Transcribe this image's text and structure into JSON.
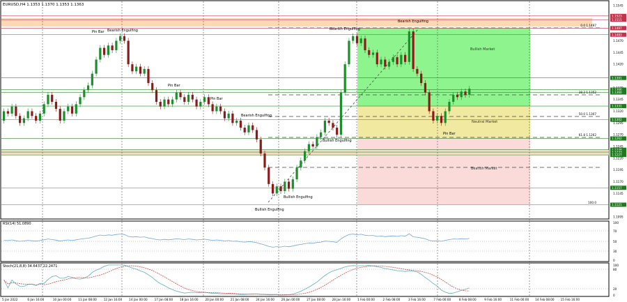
{
  "header": {
    "symbol_line": "EURUSD,H4  1.1353 1.1370 1.1353 1.1363"
  },
  "rsi_header": "RSI(14) 51.0890",
  "stoch_header": "Stoch(21,8,8) 34.6437 22.2471",
  "price_axis_ticks": [
    "1.1545",
    "1.1495",
    "1.1470",
    "1.1445",
    "1.1420",
    "1.1370",
    "1.1345",
    "1.1320",
    "1.1295",
    "1.1270",
    "1.1245",
    "1.1220",
    "1.1195",
    "1.1170",
    "1.1145",
    "1.1120",
    "1.1095"
  ],
  "price_tags": [
    {
      "value": "1.1523",
      "kind": "red"
    },
    {
      "value": "1.1515",
      "kind": "red"
    },
    {
      "value": "1.1497",
      "kind": "red"
    },
    {
      "value": "1.1483",
      "kind": "red"
    },
    {
      "value": "1.1391",
      "kind": "green"
    },
    {
      "value": "1.1366",
      "kind": "green"
    },
    {
      "value": "1.1360",
      "kind": "green"
    },
    {
      "value": "1.1331",
      "kind": "green"
    },
    {
      "value": "1.1302",
      "kind": "green"
    },
    {
      "value": "1.1262",
      "kind": "green"
    },
    {
      "value": "1.1238",
      "kind": "green"
    },
    {
      "value": "1.1233",
      "kind": "green"
    },
    {
      "value": "1.1227",
      "kind": "green"
    },
    {
      "value": "1.1157",
      "kind": "green"
    },
    {
      "value": "1.1121",
      "kind": "green"
    }
  ],
  "fib_labels": [
    {
      "text": "0.0",
      "value": "1.1497"
    },
    {
      "text": "38.2",
      "value": "1.1352"
    },
    {
      "text": "50.0",
      "value": "1.1307"
    },
    {
      "text": "61.8",
      "value": "1.1262"
    },
    {
      "text": "100.0",
      "value": ""
    }
  ],
  "annotations": [
    {
      "text": "Pin Bar"
    },
    {
      "text": "Bearish Engulfing"
    },
    {
      "text": "Bearish Engulfing"
    },
    {
      "text": "Bearish Engulfing"
    },
    {
      "text": "Pin Bar"
    },
    {
      "text": "Pin Bar"
    },
    {
      "text": "Bearish Engulfing"
    },
    {
      "text": "Bullish Engulfing"
    },
    {
      "text": "Bullish Engulfing"
    },
    {
      "text": "Bullish Engulfing"
    },
    {
      "text": "Pin Bar"
    }
  ],
  "zones": {
    "bullish": "Bullish Market",
    "neutral": "Neutral Market",
    "bearish": "Bearish Market"
  },
  "rsi_ticks": [
    "100",
    "70",
    "50",
    "30",
    "0"
  ],
  "stoch_ticks": [
    "100",
    "80",
    "20",
    "0"
  ],
  "time_labels": [
    "5 Jan 2022",
    "6 Jan 16:00",
    "10 Jan 00:00",
    "11 Jan 08:00",
    "12 Jan 16:00",
    "14 Jan 00:00",
    "17 Jan 08:00",
    "18 Jan 16:00",
    "20 Jan 00:00",
    "21 Jan 08:00",
    "24 Jan 16:00",
    "26 Jan 00:00",
    "27 Jan 08:00",
    "28 Jan 16:00",
    "1 Feb 00:00",
    "2 Feb 08:00",
    "3 Feb 16:00",
    "7 Feb 00:00",
    "8 Feb 08:00",
    "9 Feb 16:00",
    "11 Feb 00:00",
    "14 Feb 08:00",
    "15 Feb 16:00"
  ],
  "colors": {
    "bull": "#1a8f2a",
    "bear": "#8b1a1a",
    "bullish_zone": "#8ef58e",
    "neutral_zone": "#f2e9a0",
    "bearish_zone": "#fbdada",
    "supply_band": "#fcd9b4",
    "red_line": "#c0334a",
    "green_line": "#2e8b2e",
    "rsi_line": "#6ea6d8",
    "stoch_main": "#5fb0b8",
    "stoch_signal": "#d24a4a"
  },
  "chart_data": {
    "type": "candlestick",
    "symbol": "EURUSD",
    "timeframe": "H4",
    "ylim": [
      1.1095,
      1.1545
    ],
    "points": [
      [
        0,
        1.13,
        1.132
      ],
      [
        1,
        1.132,
        1.1315
      ],
      [
        2,
        1.1315,
        1.133
      ],
      [
        3,
        1.133,
        1.131
      ],
      [
        4,
        1.131,
        1.1295
      ],
      [
        5,
        1.1295,
        1.1305
      ],
      [
        6,
        1.1305,
        1.132
      ],
      [
        7,
        1.132,
        1.131
      ],
      [
        8,
        1.131,
        1.13
      ],
      [
        9,
        1.13,
        1.1315
      ],
      [
        10,
        1.1315,
        1.1335
      ],
      [
        11,
        1.1335,
        1.1355
      ],
      [
        12,
        1.1355,
        1.134
      ],
      [
        13,
        1.134,
        1.1325
      ],
      [
        14,
        1.1325,
        1.13
      ],
      [
        15,
        1.13,
        1.132
      ],
      [
        16,
        1.132,
        1.133
      ],
      [
        17,
        1.133,
        1.1315
      ],
      [
        18,
        1.1315,
        1.1335
      ],
      [
        19,
        1.1335,
        1.135
      ],
      [
        20,
        1.135,
        1.1365
      ],
      [
        21,
        1.1365,
        1.1375
      ],
      [
        22,
        1.1375,
        1.14
      ],
      [
        23,
        1.14,
        1.143
      ],
      [
        24,
        1.143,
        1.1455
      ],
      [
        25,
        1.1455,
        1.144
      ],
      [
        26,
        1.144,
        1.146
      ],
      [
        27,
        1.146,
        1.145
      ],
      [
        28,
        1.145,
        1.147
      ],
      [
        29,
        1.147,
        1.148
      ],
      [
        30,
        1.148,
        1.147
      ],
      [
        31,
        1.147,
        1.142
      ],
      [
        32,
        1.142,
        1.1405
      ],
      [
        33,
        1.1405,
        1.1415
      ],
      [
        34,
        1.1415,
        1.14
      ],
      [
        35,
        1.14,
        1.141
      ],
      [
        36,
        1.141,
        1.138
      ],
      [
        37,
        1.138,
        1.1365
      ],
      [
        38,
        1.1365,
        1.134
      ],
      [
        39,
        1.134,
        1.133
      ],
      [
        40,
        1.133,
        1.1345
      ],
      [
        41,
        1.1345,
        1.1335
      ],
      [
        42,
        1.1335,
        1.1345
      ],
      [
        43,
        1.1345,
        1.136
      ],
      [
        44,
        1.136,
        1.135
      ],
      [
        45,
        1.135,
        1.134
      ],
      [
        46,
        1.134,
        1.1355
      ],
      [
        47,
        1.1355,
        1.1345
      ],
      [
        48,
        1.1345,
        1.133
      ],
      [
        49,
        1.133,
        1.134
      ],
      [
        50,
        1.134,
        1.135
      ],
      [
        51,
        1.135,
        1.1335
      ],
      [
        52,
        1.1335,
        1.132
      ],
      [
        53,
        1.132,
        1.133
      ],
      [
        54,
        1.133,
        1.132
      ],
      [
        55,
        1.132,
        1.1305
      ],
      [
        56,
        1.1305,
        1.1315
      ],
      [
        57,
        1.1315,
        1.1295
      ],
      [
        58,
        1.1295,
        1.13
      ],
      [
        59,
        1.13,
        1.1285
      ],
      [
        60,
        1.1285,
        1.1275
      ],
      [
        61,
        1.1275,
        1.129
      ],
      [
        62,
        1.129,
        1.128
      ],
      [
        63,
        1.128,
        1.126
      ],
      [
        64,
        1.126,
        1.123
      ],
      [
        65,
        1.123,
        1.12
      ],
      [
        66,
        1.12,
        1.1165
      ],
      [
        67,
        1.1165,
        1.1145
      ],
      [
        68,
        1.1145,
        1.116
      ],
      [
        69,
        1.116,
        1.115
      ],
      [
        70,
        1.115,
        1.117
      ],
      [
        71,
        1.117,
        1.1155
      ],
      [
        72,
        1.1155,
        1.1175
      ],
      [
        73,
        1.1175,
        1.12
      ],
      [
        74,
        1.12,
        1.1215
      ],
      [
        75,
        1.1215,
        1.1235
      ],
      [
        76,
        1.1235,
        1.125
      ],
      [
        77,
        1.125,
        1.1245
      ],
      [
        78,
        1.1245,
        1.1265
      ],
      [
        79,
        1.1265,
        1.1275
      ],
      [
        80,
        1.1275,
        1.13
      ],
      [
        81,
        1.13,
        1.1295
      ],
      [
        82,
        1.1295,
        1.1285
      ],
      [
        83,
        1.1285,
        1.127
      ],
      [
        84,
        1.127,
        1.136
      ],
      [
        85,
        1.136,
        1.142
      ],
      [
        86,
        1.142,
        1.147
      ],
      [
        87,
        1.147,
        1.148
      ],
      [
        88,
        1.148,
        1.1465
      ],
      [
        89,
        1.1465,
        1.1475
      ],
      [
        90,
        1.1475,
        1.145
      ],
      [
        91,
        1.145,
        1.144
      ],
      [
        92,
        1.144,
        1.1445
      ],
      [
        93,
        1.1445,
        1.142
      ],
      [
        94,
        1.142,
        1.143
      ],
      [
        95,
        1.143,
        1.1415
      ],
      [
        96,
        1.1415,
        1.1425
      ],
      [
        97,
        1.1425,
        1.1435
      ],
      [
        98,
        1.1435,
        1.142
      ],
      [
        99,
        1.142,
        1.144
      ],
      [
        100,
        1.144,
        1.1425
      ],
      [
        101,
        1.1425,
        1.149
      ],
      [
        102,
        1.149,
        1.141
      ],
      [
        103,
        1.141,
        1.14
      ],
      [
        104,
        1.14,
        1.138
      ],
      [
        105,
        1.138,
        1.136
      ],
      [
        106,
        1.136,
        1.132
      ],
      [
        107,
        1.132,
        1.13
      ],
      [
        108,
        1.13,
        1.131
      ],
      [
        109,
        1.131,
        1.1295
      ],
      [
        110,
        1.1295,
        1.132
      ],
      [
        111,
        1.132,
        1.134
      ],
      [
        112,
        1.134,
        1.1355
      ],
      [
        113,
        1.1355,
        1.135
      ],
      [
        114,
        1.135,
        1.1362
      ],
      [
        115,
        1.1362,
        1.1355
      ],
      [
        116,
        1.1355,
        1.1368
      ]
    ]
  }
}
